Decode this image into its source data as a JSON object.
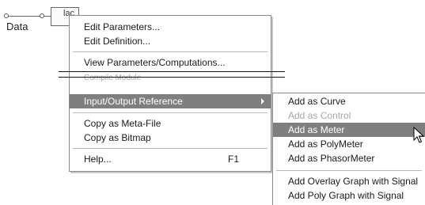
{
  "canvas": {
    "data_label": "Data",
    "component_label": "lac"
  },
  "context_menu": {
    "items": [
      {
        "label": "Edit Parameters...",
        "state": "normal"
      },
      {
        "label": "Edit Definition...",
        "state": "normal"
      },
      {
        "label": "View Parameters/Computations...",
        "state": "normal"
      },
      {
        "label": "Compile Module",
        "state": "disabled"
      },
      {
        "label": "Input/Output Reference",
        "state": "highlighted",
        "has_submenu": true
      },
      {
        "label": "Copy as Meta-File",
        "state": "normal"
      },
      {
        "label": "Copy as Bitmap",
        "state": "normal"
      },
      {
        "label": "Help...",
        "state": "normal",
        "shortcut": "F1"
      }
    ]
  },
  "submenu": {
    "items": [
      {
        "label": "Add as Curve",
        "state": "normal"
      },
      {
        "label": "Add as Control",
        "state": "disabled"
      },
      {
        "label": "Add as Meter",
        "state": "highlighted"
      },
      {
        "label": "Add as PolyMeter",
        "state": "normal"
      },
      {
        "label": "Add as PhasorMeter",
        "state": "normal"
      },
      {
        "label": "Add Overlay Graph with Signal",
        "state": "normal"
      },
      {
        "label": "Add Poly Graph with Signal",
        "state": "normal"
      }
    ]
  },
  "colors": {
    "highlight_bg": "#7f7f7f",
    "highlight_text": "#ffffff",
    "disabled_text": "#a8a8a8",
    "menu_bg": "#ffffff"
  },
  "icons": {
    "cursor": "arrow-pointer-icon",
    "submenu_arrow": "chevron-right-icon"
  }
}
